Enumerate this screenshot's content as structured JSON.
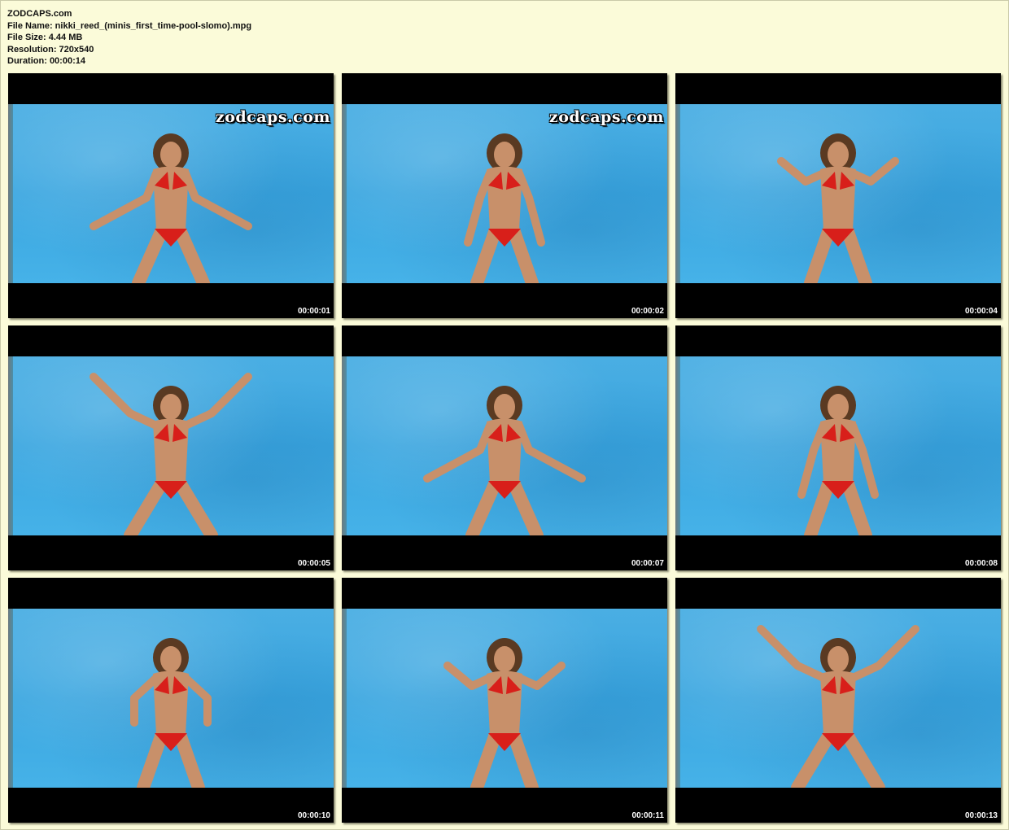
{
  "header": {
    "site": "ZODCAPS.com",
    "file_name": "File Name: nikki_reed_(minis_first_time-pool-slomo).mpg",
    "file_size": "File Size: 4.44 MB",
    "resolution": "Resolution: 720x540",
    "duration": "Duration: 00:00:14"
  },
  "watermark_text": "zodcaps.com",
  "colors": {
    "background": "#fbfbd9",
    "pool": "#3aa6e0",
    "bikini": "#d81f1a",
    "letterbox": "#000000"
  },
  "thumbnails": [
    {
      "timestamp": "00:00:01",
      "watermark": true,
      "pose": "arms-out-low"
    },
    {
      "timestamp": "00:00:02",
      "watermark": true,
      "pose": "arms-down"
    },
    {
      "timestamp": "00:00:04",
      "watermark": false,
      "pose": "arms-raised-bent"
    },
    {
      "timestamp": "00:00:05",
      "watermark": false,
      "pose": "arms-up-wide"
    },
    {
      "timestamp": "00:00:07",
      "watermark": false,
      "pose": "arms-out-low"
    },
    {
      "timestamp": "00:00:08",
      "watermark": false,
      "pose": "arms-down"
    },
    {
      "timestamp": "00:00:10",
      "watermark": false,
      "pose": "arms-bent-in"
    },
    {
      "timestamp": "00:00:11",
      "watermark": false,
      "pose": "arms-raised-bent"
    },
    {
      "timestamp": "00:00:13",
      "watermark": false,
      "pose": "arms-up-wide"
    }
  ]
}
